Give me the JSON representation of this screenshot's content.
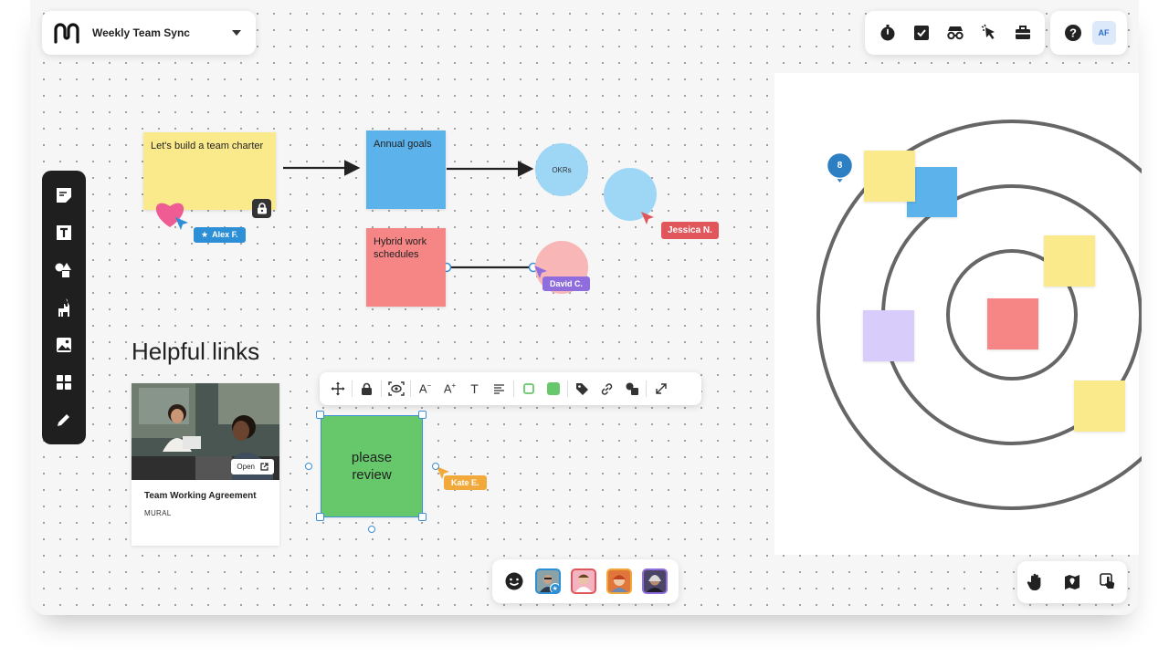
{
  "header": {
    "board_title": "Weekly Team Sync",
    "logo_icon": "mural-logo",
    "tools": [
      "timer-icon",
      "checklist-icon",
      "private-mode-icon",
      "cursor-icon",
      "toolbox-icon"
    ],
    "help_icon": "help-icon",
    "user_initials": "AF"
  },
  "left_toolbar": {
    "icons": [
      "sticky-note-icon",
      "text-box-icon",
      "shapes-icon",
      "llama-templates-icon",
      "image-icon",
      "frameworks-icon",
      "draw-icon"
    ]
  },
  "canvas": {
    "sticky_charter": "Let's build a team charter",
    "sticky_goals": "Annual goals",
    "sticky_hybrid": "Hybrid work schedules",
    "circle_okrs": "OKRs",
    "sticky_review": "please review",
    "helpful_links_heading": "Helpful links",
    "link_card": {
      "open_label": "Open",
      "title": "Team Working Agreement",
      "source": "MURAL"
    },
    "pin_count": "8"
  },
  "cursors": [
    {
      "name": "Alex F.",
      "color": "#2d8fd5"
    },
    {
      "name": "Jessica N.",
      "color": "#e0565b"
    },
    {
      "name": "David C.",
      "color": "#8f6ddc"
    },
    {
      "name": "Kate E.",
      "color": "#f2a93b"
    }
  ],
  "context_toolbar": {
    "icons": [
      "move-icon",
      "lock-icon",
      "focus-icon",
      "font-decrease-icon",
      "font-increase-icon",
      "text-icon",
      "align-icon",
      "border-color-icon",
      "fill-color-icon",
      "tag-icon",
      "link-icon",
      "layers-icon",
      "expand-icon"
    ]
  },
  "bottom_bar": {
    "reaction_icon": "emoji-icon",
    "collaborators": [
      {
        "border": "#2d8fd5"
      },
      {
        "border": "#e0565b"
      },
      {
        "border": "#f2a93b"
      },
      {
        "border": "#8f6ddc"
      }
    ]
  },
  "nav_bar": {
    "icons": [
      "hand-pan-icon",
      "map-pin-icon",
      "touch-icon"
    ]
  },
  "colors": {
    "sticky_yellow": "#fbea8c",
    "sticky_blue": "#5cb2eb",
    "sticky_red": "#f68585",
    "sticky_green": "#66c86a",
    "sticky_lavender": "#d8ccfa",
    "selection": "#3d8fd6"
  }
}
